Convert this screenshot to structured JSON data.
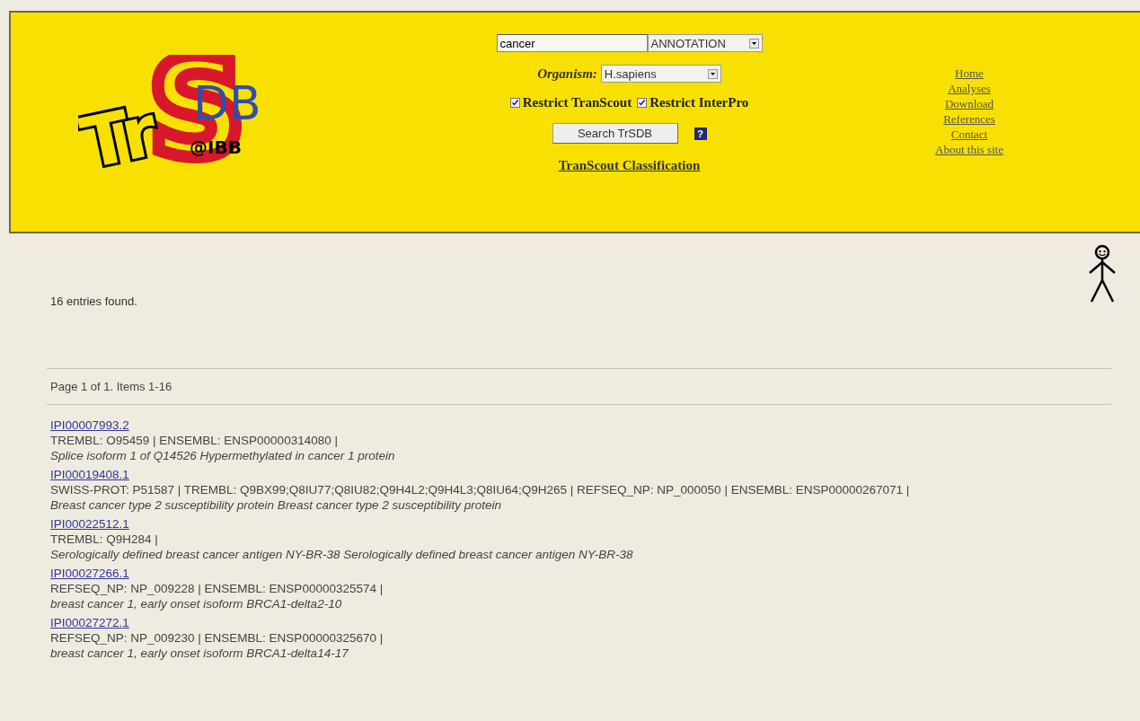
{
  "logo": {
    "letters": "Tr",
    "swash": "S",
    "suffix": "DB",
    "institute": "@IBB"
  },
  "search": {
    "query": "cancer",
    "field": "ANNOTATION",
    "organism_label": "Organism:",
    "organism": "H.sapiens",
    "options": [
      {
        "label": "Restrict TranScout",
        "checked": true
      },
      {
        "label": "Restrict InterPro",
        "checked": true
      }
    ],
    "button": "Search TrSDB",
    "help": "?",
    "classification_link": "TranScout Classification"
  },
  "nav": [
    "Home",
    "Analyses",
    "Download",
    "References",
    "Contact",
    "About this site"
  ],
  "result_count": "16 entries found.",
  "pager": "Page 1 of 1. Items 1-16",
  "entries": [
    {
      "id": "IPI00007993.2",
      "refs": "TREMBL: O95459 | ENSEMBL: ENSP00000314080 |",
      "description": "Splice isoform 1 of Q14526 Hypermethylated in cancer 1 protein"
    },
    {
      "id": "IPI00019408.1",
      "refs": "SWISS-PROT: P51587 | TREMBL: Q9BX99;Q8IU77;Q8IU82;Q9H4L2;Q9H4L3;Q8IU64;Q9H265 | REFSEQ_NP: NP_000050 | ENSEMBL: ENSP00000267071 |",
      "description": "Breast cancer type 2 susceptibility protein Breast cancer type 2 susceptibility protein"
    },
    {
      "id": "IPI00022512.1",
      "refs": "TREMBL: Q9H284 |",
      "description": "Serologically defined breast cancer antigen NY-BR-38 Serologically defined breast cancer antigen NY-BR-38"
    },
    {
      "id": "IPI00027266.1",
      "refs": "REFSEQ_NP: NP_009228 | ENSEMBL: ENSP00000325574 |",
      "description": "breast cancer 1, early onset isoform BRCA1-delta2-10"
    },
    {
      "id": "IPI00027272.1",
      "refs": "REFSEQ_NP: NP_009230 | ENSEMBL: ENSP00000325670 |",
      "description": "breast cancer 1, early onset isoform BRCA1-delta14-17"
    }
  ]
}
